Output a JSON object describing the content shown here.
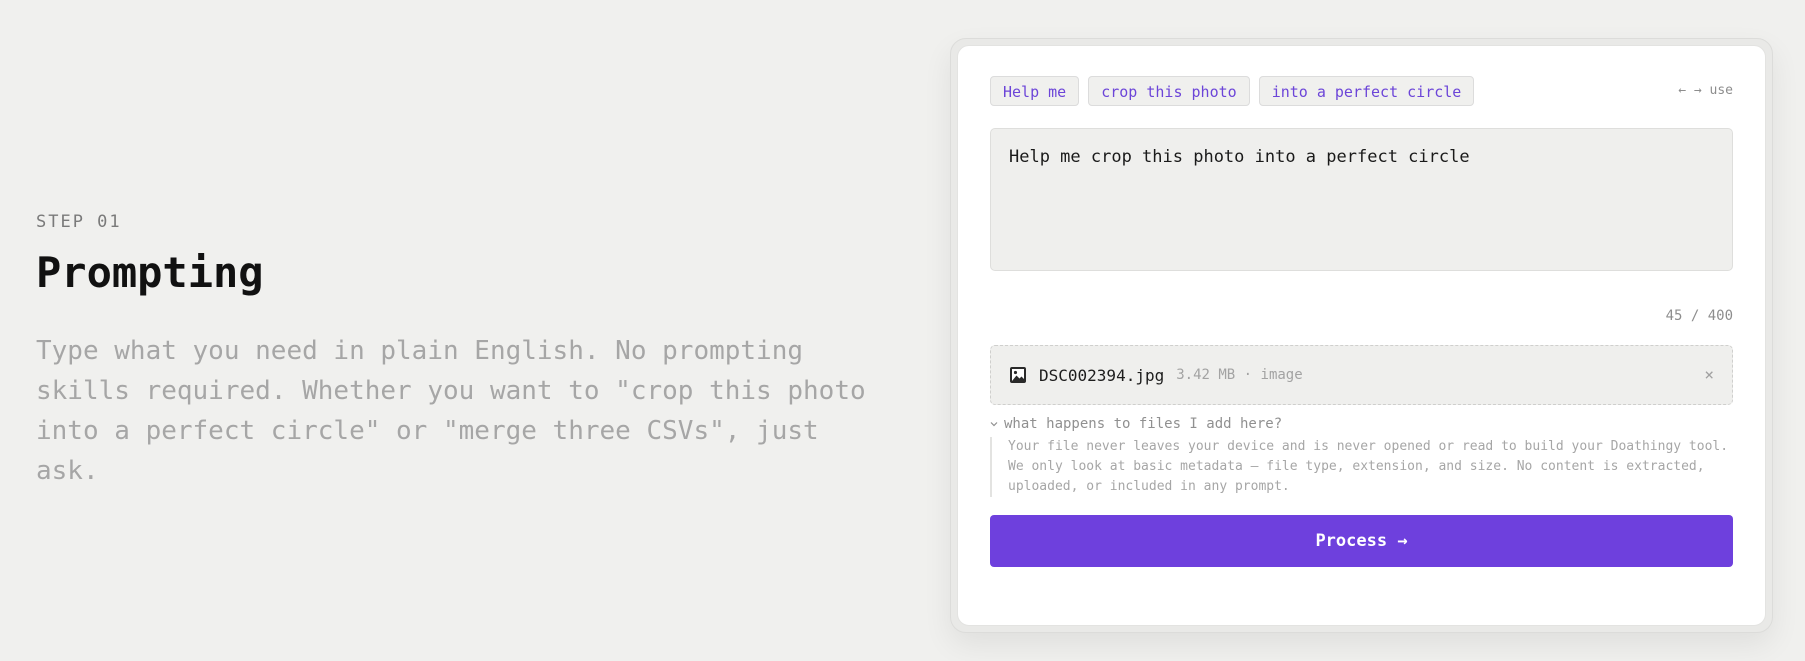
{
  "left": {
    "step_label": "STEP 01",
    "title": "Prompting",
    "description": "Type what you need in plain English. No prompting skills required. Whether you want to \"crop this photo into a perfect circle\" or \"merge three CSVs\", just ask."
  },
  "card": {
    "chips": [
      "Help me",
      "crop this photo",
      "into a perfect circle"
    ],
    "keyboard_hint": "← → use",
    "prompt_value": "Help me crop this photo into a perfect circle",
    "char_counter": "45 / 400",
    "file": {
      "icon": "image-file-icon",
      "name": "DSC002394.jpg",
      "meta": "3.42 MB · image",
      "remove_glyph": "×"
    },
    "disclosure": {
      "chevron": "›",
      "label": "what happens to files I add here?"
    },
    "privacy_note": "Your file never leaves your device and is never opened or read to build your Doathingy tool. We only look at basic metadata — file type, extension, and size. No content is extracted, uploaded, or included in any prompt.",
    "process_button": "Process →"
  },
  "colors": {
    "accent": "#6e40dd",
    "chip_text": "#6c45d8",
    "background": "#f0f0ee"
  }
}
